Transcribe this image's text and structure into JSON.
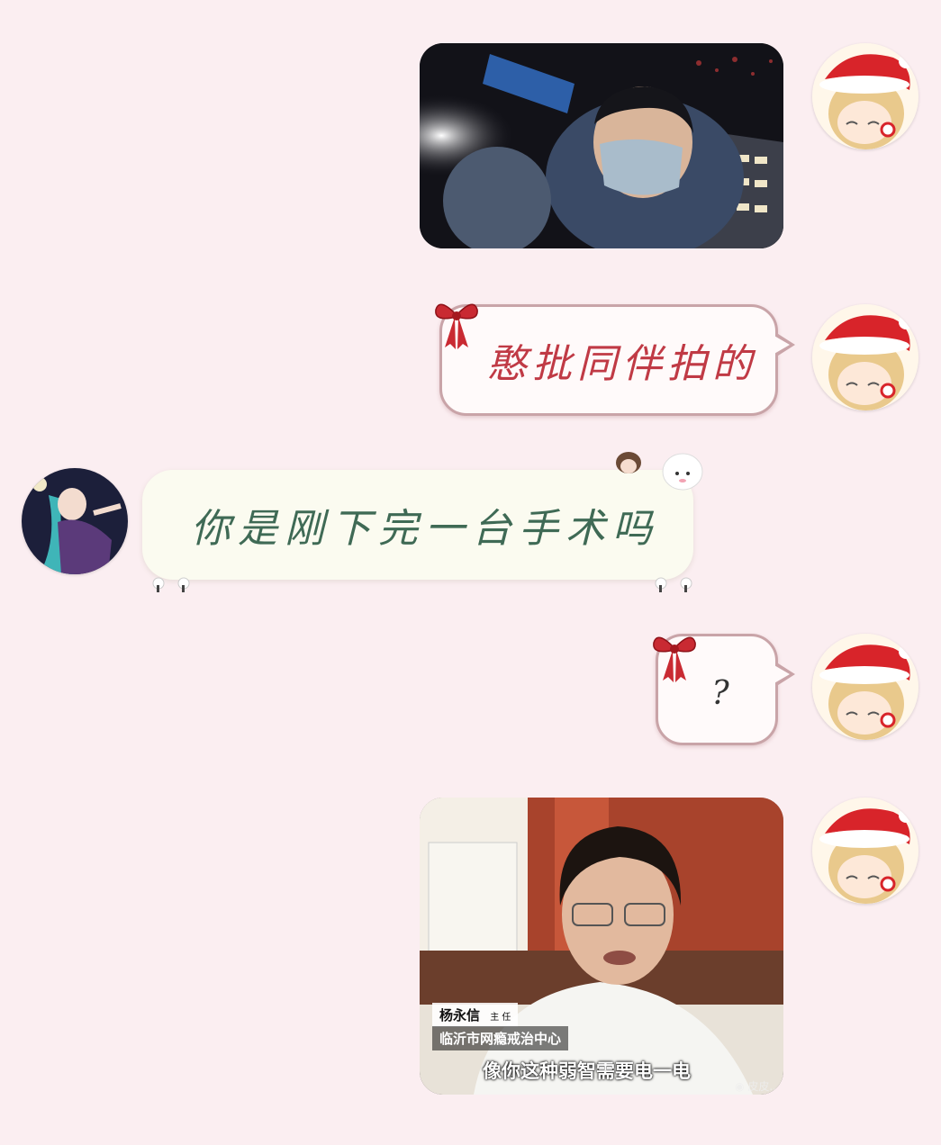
{
  "messages": [
    {
      "id": "m1",
      "side": "right",
      "type": "image",
      "image_name": "selfie-photo"
    },
    {
      "id": "m2",
      "side": "right",
      "type": "text",
      "text": "憨批同伴拍的"
    },
    {
      "id": "m3",
      "side": "left",
      "type": "text",
      "text": "你是刚下完一台手术吗"
    },
    {
      "id": "m4",
      "side": "right",
      "type": "text",
      "text": "?"
    },
    {
      "id": "m5",
      "side": "right",
      "type": "image",
      "image_name": "doctor-meme-photo",
      "caption_name": "杨永信",
      "caption_title": "主 任",
      "caption_org": "临沂市网瘾戒治中心",
      "subtitle": "像你这种弱智需要电一电",
      "watermark": "皮皮..."
    }
  ],
  "colors": {
    "background": "#fbeef1",
    "right_bubble_text": "#c03a45",
    "left_bubble_text": "#3f6a55"
  }
}
